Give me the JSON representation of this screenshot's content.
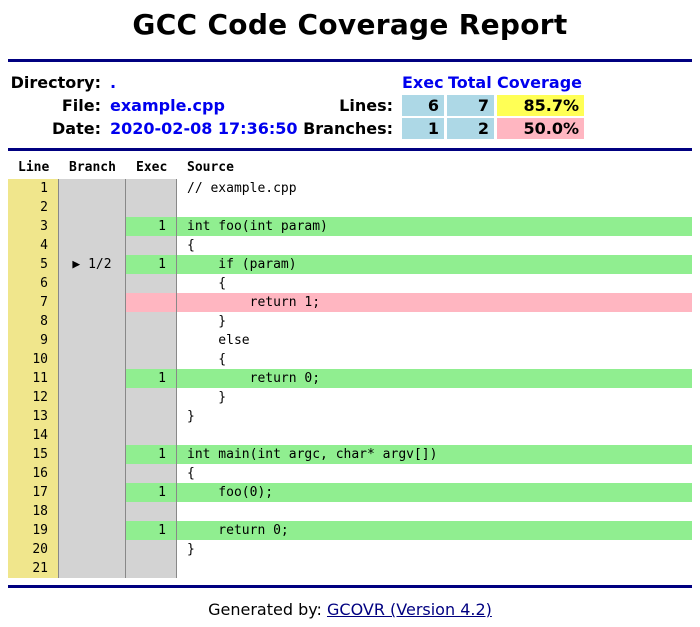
{
  "title": "GCC Code Coverage Report",
  "summary": {
    "directory_label": "Directory:",
    "directory_value": ".",
    "file_label": "File:",
    "file_value": "example.cpp",
    "date_label": "Date:",
    "date_value": "2020-02-08 17:36:50",
    "headers": {
      "exec": "Exec",
      "total": "Total",
      "coverage": "Coverage"
    },
    "lines": {
      "label": "Lines:",
      "exec": "6",
      "total": "7",
      "coverage": "85.7%"
    },
    "branches": {
      "label": "Branches:",
      "exec": "1",
      "total": "2",
      "coverage": "50.0%"
    },
    "colors": {
      "exec_bg": "#add8e6",
      "lines_cov_bg": "#ffff55",
      "branches_cov_bg": "#ffb6c1"
    }
  },
  "table": {
    "columns": {
      "line": "Line",
      "branch": "Branch",
      "exec": "Exec",
      "source": "Source"
    },
    "rows": [
      {
        "line": "1",
        "branch": "",
        "exec": "",
        "source": "// example.cpp",
        "status": "none"
      },
      {
        "line": "2",
        "branch": "",
        "exec": "",
        "source": "",
        "status": "none"
      },
      {
        "line": "3",
        "branch": "",
        "exec": "1",
        "source": "int foo(int param)",
        "status": "covered"
      },
      {
        "line": "4",
        "branch": "",
        "exec": "",
        "source": "{",
        "status": "none"
      },
      {
        "line": "5",
        "branch": "▶ 1/2",
        "exec": "1",
        "source": "    if (param)",
        "status": "covered"
      },
      {
        "line": "6",
        "branch": "",
        "exec": "",
        "source": "    {",
        "status": "none"
      },
      {
        "line": "7",
        "branch": "",
        "exec": "",
        "source": "        return 1;",
        "status": "uncovered"
      },
      {
        "line": "8",
        "branch": "",
        "exec": "",
        "source": "    }",
        "status": "none"
      },
      {
        "line": "9",
        "branch": "",
        "exec": "",
        "source": "    else",
        "status": "none"
      },
      {
        "line": "10",
        "branch": "",
        "exec": "",
        "source": "    {",
        "status": "none"
      },
      {
        "line": "11",
        "branch": "",
        "exec": "1",
        "source": "        return 0;",
        "status": "covered"
      },
      {
        "line": "12",
        "branch": "",
        "exec": "",
        "source": "    }",
        "status": "none"
      },
      {
        "line": "13",
        "branch": "",
        "exec": "",
        "source": "}",
        "status": "none"
      },
      {
        "line": "14",
        "branch": "",
        "exec": "",
        "source": "",
        "status": "none"
      },
      {
        "line": "15",
        "branch": "",
        "exec": "1",
        "source": "int main(int argc, char* argv[])",
        "status": "covered"
      },
      {
        "line": "16",
        "branch": "",
        "exec": "",
        "source": "{",
        "status": "none"
      },
      {
        "line": "17",
        "branch": "",
        "exec": "1",
        "source": "    foo(0);",
        "status": "covered"
      },
      {
        "line": "18",
        "branch": "",
        "exec": "",
        "source": "",
        "status": "none"
      },
      {
        "line": "19",
        "branch": "",
        "exec": "1",
        "source": "    return 0;",
        "status": "covered"
      },
      {
        "line": "20",
        "branch": "",
        "exec": "",
        "source": "}",
        "status": "none"
      },
      {
        "line": "21",
        "branch": "",
        "exec": "",
        "source": "",
        "status": "none"
      }
    ]
  },
  "footer": {
    "prefix": "Generated by: ",
    "link_text": "GCOVR (Version 4.2)"
  },
  "colors": {
    "rule": "#000080",
    "line_col_bg": "#f0e68c",
    "gray_col_bg": "#d3d3d3",
    "covered_bg": "#90ee90",
    "uncovered_bg": "#ffb6c1"
  }
}
